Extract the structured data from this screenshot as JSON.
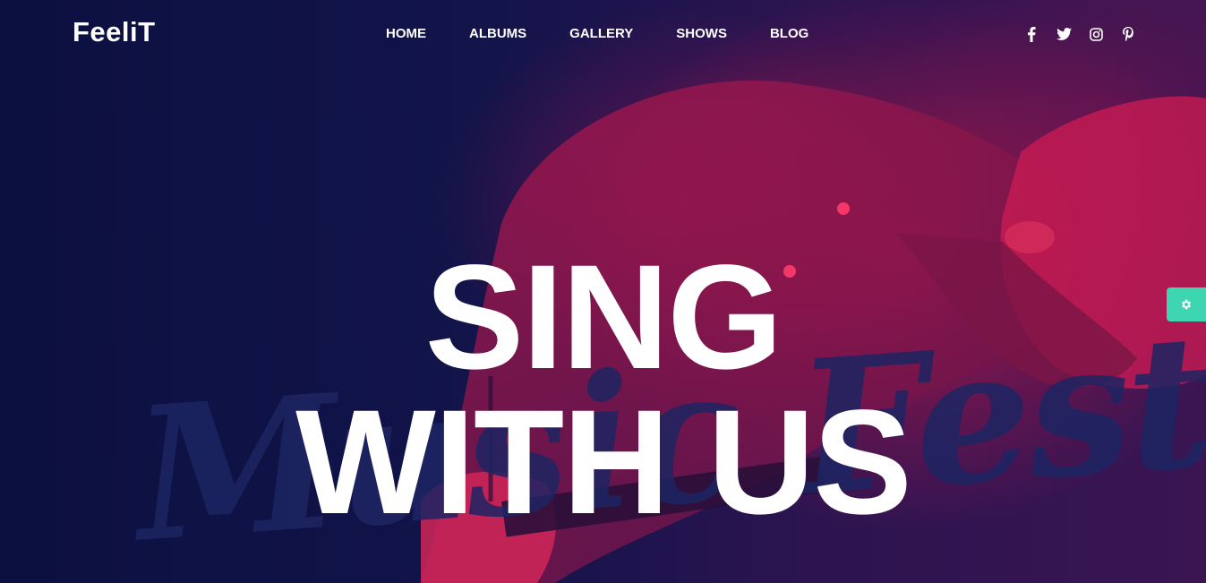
{
  "brand": {
    "logo_text": "FeeliT"
  },
  "nav": {
    "items": [
      {
        "label": "HOME"
      },
      {
        "label": "ALBUMS"
      },
      {
        "label": "GALLERY"
      },
      {
        "label": "SHOWS"
      },
      {
        "label": "BLOG"
      }
    ]
  },
  "social": {
    "icons": [
      "facebook-icon",
      "twitter-icon",
      "instagram-icon",
      "pinterest-icon"
    ]
  },
  "hero": {
    "headline_line1": "SING",
    "headline_line2": "WITH US",
    "watermark": "Music Festival"
  },
  "settings": {
    "icon": "gear-icon"
  },
  "colors": {
    "background": "#0d1142",
    "accent_red": "#c4164a",
    "settings_teal": "#3ed6b0",
    "text": "#ffffff"
  }
}
